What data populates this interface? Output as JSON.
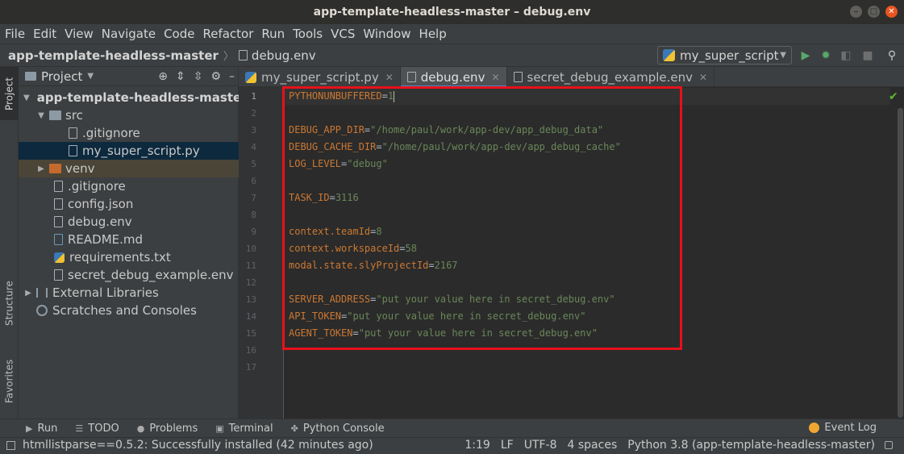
{
  "window": {
    "title": "app-template-headless-master – debug.env"
  },
  "menu": [
    "File",
    "Edit",
    "View",
    "Navigate",
    "Code",
    "Refactor",
    "Run",
    "Tools",
    "VCS",
    "Window",
    "Help"
  ],
  "breadcrumb": {
    "project": "app-template-headless-master",
    "file": "debug.env"
  },
  "run_config": {
    "label": "my_super_script"
  },
  "side_tabs": {
    "project": "Project",
    "structure": "Structure",
    "favorites": "Favorites"
  },
  "project_panel": {
    "title": "Project",
    "tree": {
      "root": "app-template-headless-master",
      "src": "src",
      "src_gitignore": ".gitignore",
      "src_script": "my_super_script.py",
      "venv": "venv",
      "gitignore": ".gitignore",
      "config": "config.json",
      "debug_env": "debug.env",
      "readme": "README.md",
      "requirements": "requirements.txt",
      "secret_example": "secret_debug_example.env",
      "external": "External Libraries",
      "scratches": "Scratches and Consoles"
    }
  },
  "tabs": [
    "my_super_script.py",
    "debug.env",
    "secret_debug_example.env"
  ],
  "editor": {
    "line_numbers": [
      "1",
      "2",
      "3",
      "4",
      "5",
      "6",
      "7",
      "8",
      "9",
      "10",
      "11",
      "12",
      "13",
      "14",
      "15",
      "16",
      "17"
    ],
    "lines": [
      {
        "key": "PYTHONUNBUFFERED",
        "eq": "=",
        "value": "1"
      },
      {
        "key": "",
        "eq": "",
        "value": ""
      },
      {
        "key": "DEBUG_APP_DIR",
        "eq": "=",
        "value": "\"/home/paul/work/app-dev/app_debug_data\""
      },
      {
        "key": "DEBUG_CACHE_DIR",
        "eq": "=",
        "value": "\"/home/paul/work/app-dev/app_debug_cache\""
      },
      {
        "key": "LOG_LEVEL",
        "eq": "=",
        "value": "\"debug\""
      },
      {
        "key": "",
        "eq": "",
        "value": ""
      },
      {
        "key": "TASK_ID",
        "eq": "=",
        "value": "3116"
      },
      {
        "key": "",
        "eq": "",
        "value": ""
      },
      {
        "key": "context.teamId",
        "eq": "=",
        "value": "8"
      },
      {
        "key": "context.workspaceId",
        "eq": "=",
        "value": "58"
      },
      {
        "key": "modal.state.slyProjectId",
        "eq": "=",
        "value": "2167"
      },
      {
        "key": "",
        "eq": "",
        "value": ""
      },
      {
        "key": "SERVER_ADDRESS",
        "eq": "=",
        "value": "\"put your value here in secret_debug.env\""
      },
      {
        "key": "API_TOKEN",
        "eq": "=",
        "value": "\"put your value here in secret_debug.env\""
      },
      {
        "key": "AGENT_TOKEN",
        "eq": "=",
        "value": "\"put your value here in secret_debug.env\""
      },
      {
        "key": "",
        "eq": "",
        "value": ""
      },
      {
        "key": "",
        "eq": "",
        "value": ""
      }
    ]
  },
  "bottom_tools": [
    "Run",
    "TODO",
    "Problems",
    "Terminal",
    "Python Console"
  ],
  "event_log": "Event Log",
  "status": {
    "message": "htmllistparse==0.5.2: Successfully installed (42 minutes ago)",
    "position": "1:19",
    "line_sep": "LF",
    "encoding": "UTF-8",
    "indent": "4 spaces",
    "interpreter": "Python 3.8 (app-template-headless-master)"
  },
  "colors": {
    "key": "#cc7832",
    "value": "#6a8759",
    "highlight": "#e8101a",
    "accent": "#4a88c7"
  }
}
